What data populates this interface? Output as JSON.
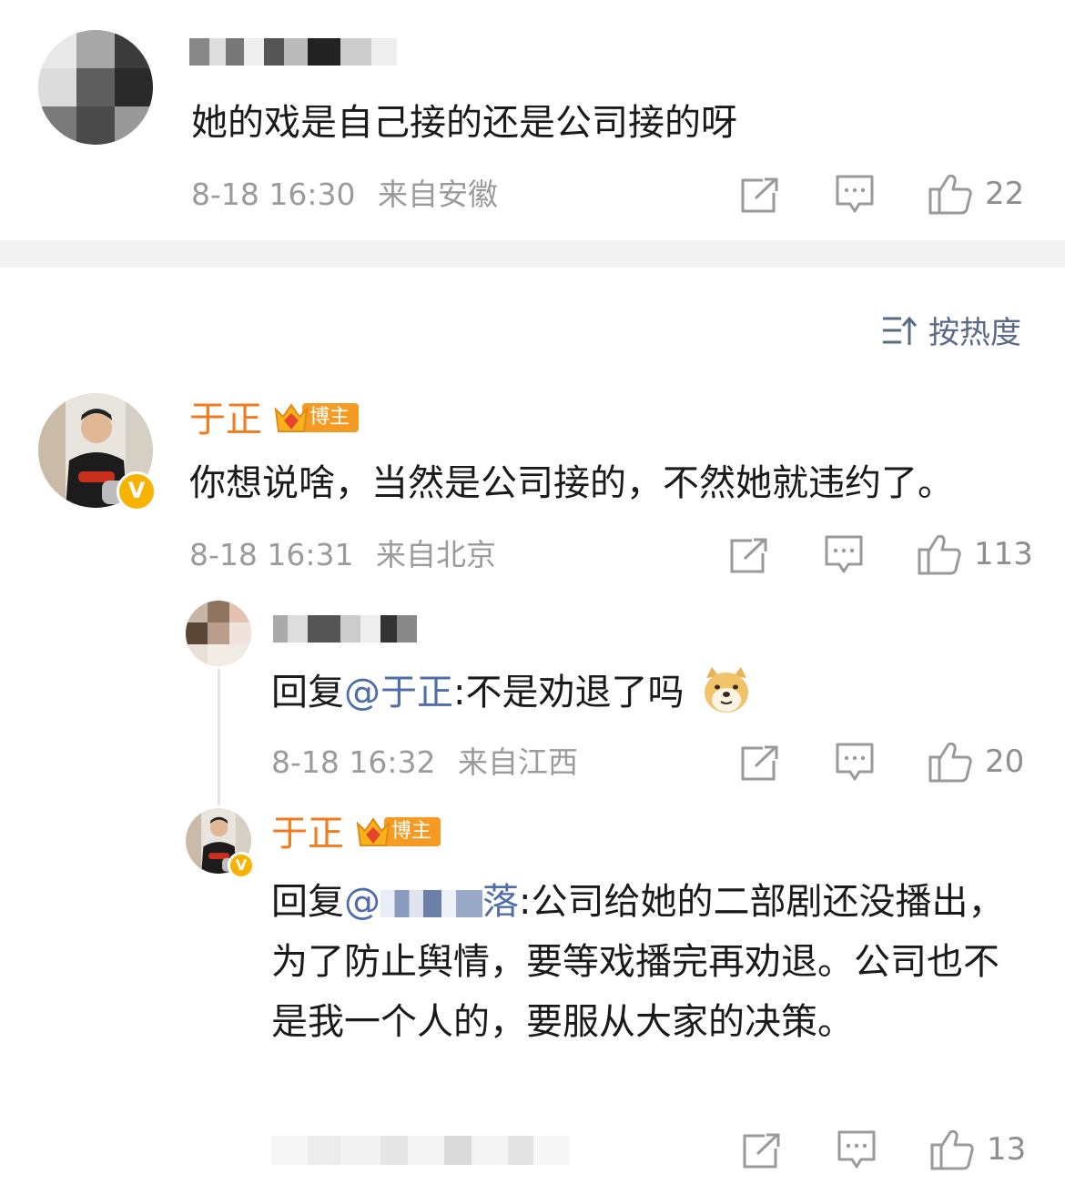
{
  "colors": {
    "name_orange": "#f37b1d",
    "badge_orange": "#f59a23",
    "meta_gray": "#9b9b9b",
    "mention_blue": "#4f6ea8",
    "sort_blue": "#5b6a86"
  },
  "top_comment": {
    "text": "她的戏是自己接的还是公司接的呀",
    "time": "8-18 16:30",
    "location": "来自安徽",
    "likes": "22"
  },
  "sort": {
    "label": "按热度",
    "icon": "sort-icon"
  },
  "main_comment": {
    "author": "于正",
    "badge": "博主",
    "text": "你想说啥，当然是公司接的，不然她就违约了。",
    "time": "8-18 16:31",
    "location": "来自北京",
    "likes": "113"
  },
  "reply_1": {
    "reply_prefix": "回复",
    "mention": "@于正",
    "text": ":不是劝退了吗",
    "emoji": "doge-emoji",
    "time": "8-18 16:32",
    "location": "来自江西",
    "likes": "20"
  },
  "reply_2": {
    "author": "于正",
    "badge": "博主",
    "reply_prefix": "回复",
    "mention": "@",
    "mention_tail": "落",
    "text": ":公司给她的二部剧还没播出，为了防止舆情，要等戏播完再劝退。公司也不是我一个人的，要服从大家的决策。",
    "likes": "13"
  }
}
